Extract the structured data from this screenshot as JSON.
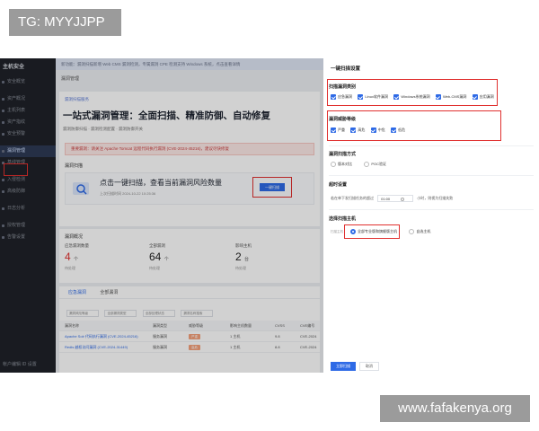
{
  "watermark_top": "TG: MYYJJPP",
  "watermark_bottom": "www.fafakenya.org",
  "sidebar": {
    "brand": "主机安全",
    "items": [
      {
        "label": "安全概览"
      },
      {
        "label": "资产概况"
      },
      {
        "label": "主机列表"
      },
      {
        "label": "资产指纹"
      },
      {
        "label": "安全预警"
      },
      {
        "label": "漏洞管理"
      },
      {
        "label": "基线管理"
      },
      {
        "label": "入侵检测"
      },
      {
        "label": "高级防御"
      },
      {
        "label": "日志分析"
      },
      {
        "label": "授权管理"
      },
      {
        "label": "告警设置"
      }
    ],
    "footer": "帐户编辑 ID 设置"
  },
  "main": {
    "banner": "新功能：漏洞扫描新增 Web CMS 漏洞检测，专属漏洞 CPE 检测支持 Windows 系统，点击查看详情",
    "breadcrumb": "漏洞管理",
    "hero": {
      "sub": "漏洞扫描服务",
      "title": "一站式漏洞管理：全面扫描、精准防御、自动修复",
      "meta_1": "漏洞防御扫描",
      "meta_2": "漏洞检测配置",
      "meta_3": "漏洞防御开关"
    },
    "alert": "重要漏洞：请关注 Apache Tomcat 远程代码执行漏洞 (CVE-2024-45216)，建议尽快修复",
    "scan": {
      "label": "漏洞扫描",
      "headline": "点击一键扫描，查看当前漏洞风险数量",
      "time": "上次扫描时间 2024-10-22 10:25:36",
      "button": "一键扫描"
    },
    "overview": {
      "label": "漏洞概况",
      "cols": [
        {
          "k": "应急漏洞数量",
          "v": "4",
          "unit": "个",
          "sub": "待处理"
        },
        {
          "k": "全部漏洞",
          "v": "64",
          "unit": "个",
          "sub": "待处理"
        },
        {
          "k": "影响主机",
          "v": "2",
          "unit": "台",
          "sub": "待处理"
        }
      ]
    },
    "tabs": [
      "应急漏洞",
      "全部漏洞"
    ],
    "filters": [
      "漏洞风险等级",
      "全部漏洞类型",
      "全部处理状态",
      "漏洞名称搜索"
    ],
    "table": {
      "headers": [
        "漏洞名称",
        "漏洞类型",
        "威胁等级",
        "影响主机数量",
        "CVSS",
        "CVE编号"
      ],
      "rows": [
        {
          "name": "Apache Solr 代码执行漏洞 (CVE-2024-45216)",
          "tag": "应急漏洞",
          "type": "服务漏洞",
          "level": "严重",
          "hosts": "1 主机",
          "cvss": "9.8",
          "cve": "CVE-2024"
        },
        {
          "name": "Redis 越权访问漏洞 (CVE-2024-31449)",
          "tag": "应急漏洞",
          "type": "服务漏洞",
          "level": "高危",
          "hosts": "1 主机",
          "cvss": "8.8",
          "cve": "CVE-2024"
        }
      ]
    }
  },
  "drawer": {
    "title": "一键扫描设置",
    "types_title": "扫描漏洞类别",
    "types": [
      "应急漏洞",
      "Linux软件漏洞",
      "Windows系统漏洞",
      "Web-CMS漏洞",
      "应用漏洞"
    ],
    "levels_title": "漏洞威胁等级",
    "levels": [
      "严重",
      "高危",
      "中危",
      "低危"
    ],
    "method_title": "漏洞扫描方式",
    "methods": [
      "版本对比",
      "POC验证"
    ],
    "timeout_title": "超时设置",
    "timeout_prefix": "若在单下发扫描任务的超过",
    "timeout_value": "01:00",
    "timeout_suffix": "小时，则视为扫描失败",
    "hosts_title": "选择扫描主机",
    "hosts_label": "扫描主机",
    "hosts": [
      "全部专业版和旗舰版主机",
      "自选主机"
    ],
    "save": "立即扫描",
    "cancel": "取消"
  }
}
